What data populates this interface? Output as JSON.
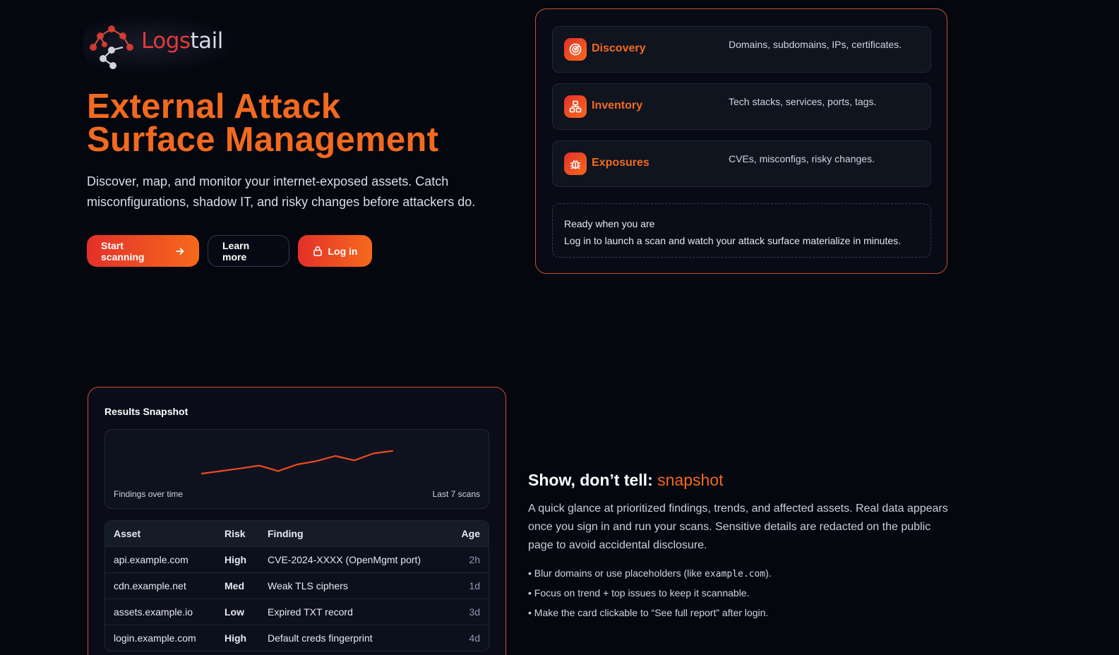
{
  "brand": {
    "name_a": "Logs",
    "name_b": "tail"
  },
  "hero": {
    "title_line1": "External Attack",
    "title_line2": "Surface Management",
    "subtitle": "Discover, map, and monitor your internet-exposed assets. Catch misconfigurations, shadow IT, and risky changes before attackers do."
  },
  "buttons": {
    "start": "Start scanning",
    "learn": "Learn more",
    "login": "Log in"
  },
  "features": [
    {
      "name": "Discovery",
      "desc": "Domains, subdomains, IPs, certificates.",
      "icon": "radar-icon"
    },
    {
      "name": "Inventory",
      "desc": "Tech stacks, services, ports, tags.",
      "icon": "network-icon"
    },
    {
      "name": "Exposures",
      "desc": "CVEs, misconfigs, risky changes.",
      "icon": "bug-icon"
    }
  ],
  "ready": {
    "title": "Ready when you are",
    "text": "Log in to launch a scan and watch your attack surface materialize in minutes."
  },
  "snapshot": {
    "title": "Results Snapshot",
    "trend_label_left": "Findings over time",
    "trend_label_right": "Last 7 scans",
    "columns": [
      "Asset",
      "Risk",
      "Finding",
      "Age"
    ],
    "rows": [
      {
        "asset": "api.example.com",
        "risk": "High",
        "finding": "CVE-2024-XXXX (OpenMgmt port)",
        "age": "2h"
      },
      {
        "asset": "cdn.example.net",
        "risk": "Med",
        "finding": "Weak TLS ciphers",
        "age": "1d"
      },
      {
        "asset": "assets.example.io",
        "risk": "Low",
        "finding": "Expired TXT record",
        "age": "3d"
      },
      {
        "asset": "login.example.com",
        "risk": "High",
        "finding": "Default creds fingerprint",
        "age": "4d"
      }
    ]
  },
  "chart_data": {
    "type": "line",
    "x": [
      1,
      2,
      3,
      4,
      5,
      6,
      7,
      8,
      9,
      10,
      11
    ],
    "values": [
      0,
      7,
      14,
      22,
      7,
      25,
      34,
      48,
      36,
      55,
      62
    ],
    "ylim": [
      0,
      100
    ],
    "grid": false,
    "color": "#ef4a1f"
  },
  "show": {
    "title_a": "Show, don’t tell:",
    "title_b": "snapshot",
    "text": "A quick glance at prioritized findings, trends, and affected assets. Real data appears once you sign in and run your scans. Sensitive details are redacted on the public page to avoid accidental disclosure.",
    "bullet1_pre": "• Blur domains or use placeholders (like ",
    "bullet1_code": "example.com",
    "bullet1_post": ").",
    "bullet2": "• Focus on trend + top issues to keep it scannable.",
    "bullet3": "• Make the card clickable to “See full report” after login."
  },
  "colors": {
    "accent": "#f26a1f",
    "accent_red": "#e3302a",
    "background": "#05070f"
  }
}
